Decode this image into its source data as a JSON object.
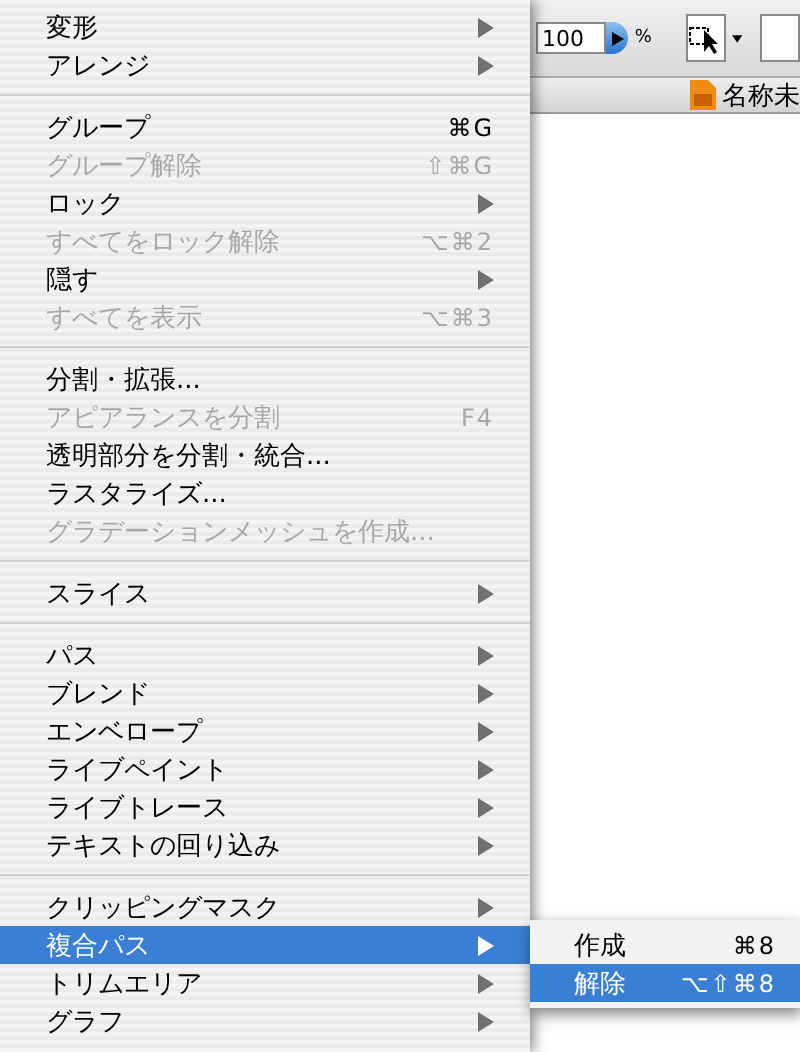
{
  "toolbar": {
    "opacity_field": {
      "value": "100"
    },
    "unit": "%"
  },
  "document_tab": {
    "title": "名称未"
  },
  "menu": {
    "groups": [
      [
        {
          "label": "変形",
          "disabled": false,
          "submenu": true,
          "selected": false
        },
        {
          "label": "アレンジ",
          "disabled": false,
          "submenu": true,
          "selected": false
        }
      ],
      [
        {
          "label": "グループ",
          "shortcut": "⌘G",
          "disabled": false,
          "submenu": false,
          "selected": false
        },
        {
          "label": "グループ解除",
          "shortcut": "⇧⌘G",
          "disabled": true,
          "submenu": false,
          "selected": false
        },
        {
          "label": "ロック",
          "disabled": false,
          "submenu": true,
          "selected": false
        },
        {
          "label": "すべてをロック解除",
          "shortcut": "⌥⌘2",
          "disabled": true,
          "submenu": false,
          "selected": false
        },
        {
          "label": "隠す",
          "disabled": false,
          "submenu": true,
          "selected": false
        },
        {
          "label": "すべてを表示",
          "shortcut": "⌥⌘3",
          "disabled": true,
          "submenu": false,
          "selected": false
        }
      ],
      [
        {
          "label": "分割・拡張...",
          "disabled": false,
          "submenu": false,
          "selected": false
        },
        {
          "label": "アピアランスを分割",
          "shortcut": "F4",
          "disabled": true,
          "submenu": false,
          "selected": false
        },
        {
          "label": "透明部分を分割・統合...",
          "disabled": false,
          "submenu": false,
          "selected": false
        },
        {
          "label": "ラスタライズ...",
          "disabled": false,
          "submenu": false,
          "selected": false
        },
        {
          "label": "グラデーションメッシュを作成...",
          "disabled": true,
          "submenu": false,
          "selected": false
        }
      ],
      [
        {
          "label": "スライス",
          "disabled": false,
          "submenu": true,
          "selected": false
        }
      ],
      [
        {
          "label": "パス",
          "disabled": false,
          "submenu": true,
          "selected": false
        },
        {
          "label": "ブレンド",
          "disabled": false,
          "submenu": true,
          "selected": false
        },
        {
          "label": "エンベロープ",
          "disabled": false,
          "submenu": true,
          "selected": false
        },
        {
          "label": "ライブペイント",
          "disabled": false,
          "submenu": true,
          "selected": false
        },
        {
          "label": "ライブトレース",
          "disabled": false,
          "submenu": true,
          "selected": false
        },
        {
          "label": "テキストの回り込み",
          "disabled": false,
          "submenu": true,
          "selected": false
        }
      ],
      [
        {
          "label": "クリッピングマスク",
          "disabled": false,
          "submenu": true,
          "selected": false
        },
        {
          "label": "複合パス",
          "disabled": false,
          "submenu": true,
          "selected": true,
          "items": [
            {
              "label": "作成",
              "shortcut": "⌘8",
              "selected": false
            },
            {
              "label": "解除",
              "shortcut": "⌥⇧⌘8",
              "selected": true
            }
          ]
        },
        {
          "label": "トリムエリア",
          "disabled": false,
          "submenu": true,
          "selected": false
        },
        {
          "label": "グラフ",
          "disabled": false,
          "submenu": true,
          "selected": false
        }
      ]
    ]
  }
}
